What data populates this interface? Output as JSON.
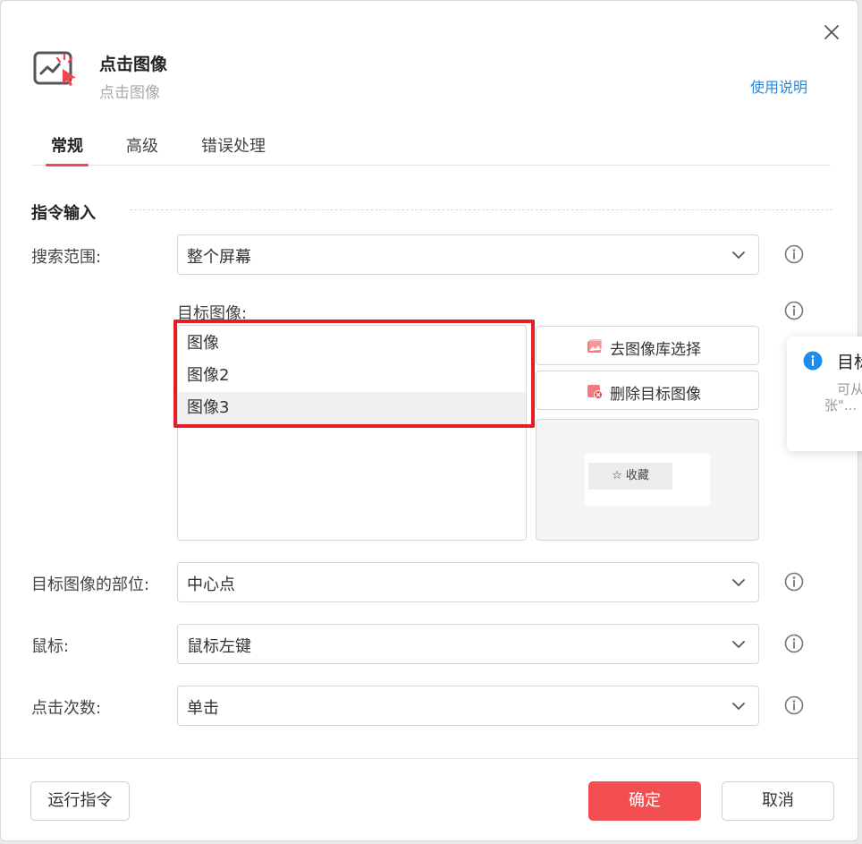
{
  "header": {
    "title": "点击图像",
    "subtitle": "点击图像",
    "help_link": "使用说明"
  },
  "tabs": [
    {
      "label": "常规",
      "active": true
    },
    {
      "label": "高级",
      "active": false
    },
    {
      "label": "错误处理",
      "active": false
    }
  ],
  "section": {
    "title": "指令输入"
  },
  "search_range": {
    "label": "搜索范围:",
    "value": "整个屏幕"
  },
  "target_image": {
    "label": "目标图像:",
    "items": [
      "图像",
      "图像2",
      "图像3"
    ],
    "selected_index": 2,
    "library_button": "去图像库选择",
    "delete_button": "删除目标图像",
    "preview_chip": "☆ 收藏"
  },
  "target_part": {
    "label": "目标图像的部位:",
    "value": "中心点"
  },
  "mouse": {
    "label": "鼠标:",
    "value": "鼠标左键"
  },
  "click_count": {
    "label": "点击次数:",
    "value": "单击"
  },
  "toast": {
    "title": "目标",
    "line1": "可从",
    "line2": "张\"..."
  },
  "footer": {
    "run_button": "运行指令",
    "ok_button": "确定",
    "cancel_button": "取消"
  },
  "colors": {
    "accent": "#f44f50",
    "link": "#2a87d8",
    "highlight": "#e31e24",
    "info": "#1f8ceb"
  },
  "icons": {
    "close": "close-icon",
    "header": "click-image-icon",
    "info": "info-icon",
    "chevron": "chevron-down-icon"
  }
}
